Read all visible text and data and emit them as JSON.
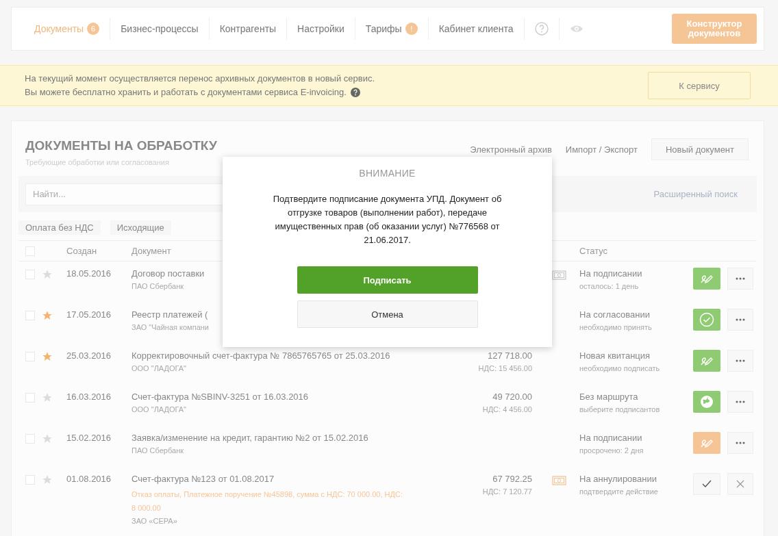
{
  "nav": {
    "items": [
      {
        "label": "Документы",
        "badge": "6",
        "selected": true
      },
      {
        "label": "Бизнес-процессы",
        "selected": false
      },
      {
        "label": "Контрагенты",
        "selected": false
      },
      {
        "label": "Настройки",
        "selected": false
      },
      {
        "label": "Тарифы",
        "badge": "!",
        "selected": false
      },
      {
        "label": "Кабинет клиента",
        "selected": false
      }
    ],
    "constructor_button": "Конструктор документов"
  },
  "banner": {
    "lines": [
      "На текущий момент осуществляется перенос архивных документов в новый сервис.",
      "Вы можете бесплатно хранить и работать с документами сервиса E-invoicing."
    ],
    "button": "К сервису"
  },
  "panel": {
    "title": "ДОКУМЕНТЫ НА ОБРАБОТКУ",
    "subtitle": "Требующие обработки или согласования",
    "links": [
      "Электронный архив",
      "Импорт / Экспорт"
    ],
    "new_button": "Новый документ",
    "search": {
      "placeholder": "Найти..."
    },
    "advanced_search": "Расширенный поиск",
    "filters": [
      "Оплата без НДС",
      "Исходящие"
    ],
    "columns": [
      "Создан",
      "Документ",
      "Статус"
    ],
    "header_checked": false,
    "rows": [
      {
        "checked": false,
        "starred": false,
        "date": "18.05.2016",
        "title": "Договор поставки",
        "org": "ПАО Сбербанк",
        "payment": {
          "color": "#c8c8c8"
        },
        "status": "На подписании",
        "status_note": "осталось: 1 день",
        "action": {
          "kind": "sign",
          "color": "#8fcb73"
        }
      },
      {
        "checked": false,
        "starred": true,
        "date": "17.05.2016",
        "title": "Реестр платежей (",
        "org": "ЗАО \"Чайная компани",
        "status": "На согласовании",
        "status_note": "необходимо принять",
        "action": {
          "kind": "approve",
          "color": "#8fcb73"
        }
      },
      {
        "checked": false,
        "starred": true,
        "date": "25.03.2016",
        "title": "Корректировочный счет-фактура № 7865765765 от 25.03.2016",
        "org": "ООО \"ЛАДОГА\"",
        "amount": "127 718.00",
        "vat": "НДС: 15 456.00",
        "status": "Новая квитанция",
        "status_note": "необходимо подписать",
        "action": {
          "kind": "sign",
          "color": "#8fcb73"
        }
      },
      {
        "checked": false,
        "starred": false,
        "date": "16.03.2016",
        "title": "Счет-фактура №SBINV-3251 от 16.03.2016",
        "org": "ООО \"ЛАДОГА\"",
        "amount": "49 720.00",
        "vat": "НДС: 4 456.00",
        "status": "Без маршрута",
        "status_note": "выберите подписантов",
        "action": {
          "kind": "route",
          "color": "#8fcb73"
        }
      },
      {
        "checked": false,
        "starred": false,
        "date": "15.02.2016",
        "title": "Заявка/изменение на кредит, гарантию №2 от 15.02.2016",
        "org": "ПАО Сбербанк",
        "status": "На подписании",
        "status_note": "просрочено: 2 дня",
        "action": {
          "kind": "sign",
          "color": "#f5c596"
        }
      },
      {
        "checked": false,
        "starred": false,
        "date": "01.08.2016",
        "title": "Счет-фактура №123 от 01.08.2017",
        "note": "Отказ оплаты, Платежное поручение №45898, сумма с НДС: 70 000.00, НДС: 8 000.00",
        "org": "ЗАО «СЕРА»",
        "amount": "67 792.25",
        "vat": "НДС: 7 120.77",
        "payment": {
          "color": "#f5c596"
        },
        "status": "На аннулировании",
        "status_note": "подтвердите действие",
        "action": {
          "kind": "confirm"
        }
      }
    ]
  },
  "modal": {
    "title": "ВНИМАНИЕ",
    "message": "Подтвердите подписание документа УПД. Документ об отгрузке товаров (выполнении работ), передаче имущественных прав (об оказании услуг) №776568 от 21.06.2017.",
    "confirm": "Подписать",
    "cancel": "Отмена"
  }
}
